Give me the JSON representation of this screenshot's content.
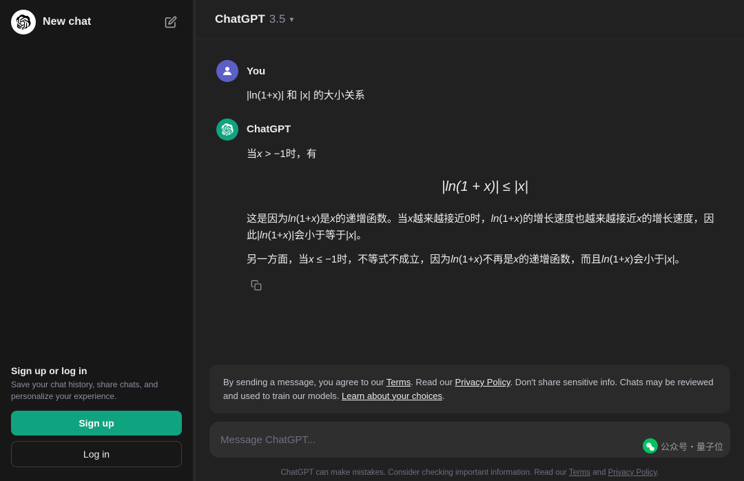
{
  "sidebar": {
    "brand": {
      "title": "New chat"
    },
    "new_chat_label": "New chat"
  },
  "header": {
    "model_name": "ChatGPT",
    "model_version": "3.5",
    "chevron": "▾"
  },
  "messages": [
    {
      "role": "user",
      "author": "You",
      "content": "|ln(1+x)| 和 |x| 的大小关系"
    },
    {
      "role": "assistant",
      "author": "ChatGPT",
      "intro": "当x > −1时，有",
      "math_block": "|ln(1 + x)| ≤ |x|",
      "para1": "这是因为ln(1+x)是x的递增函数。当x越来越接近0时，ln(1+x)的增长速度也越来越接近x的增长速度，因此|ln(1+x)|会小于等于|x|。",
      "para2": "另一方面，当x ≤ −1时，不等式不成立，因为ln(1+x)不再是x的递增函数，而且ln(1+x)会小于|x|。"
    }
  ],
  "disclaimer": {
    "text1": "By sending a message, you agree to our ",
    "terms_label": "Terms",
    "text2": ". Read our ",
    "privacy_label": "Privacy Policy",
    "text3": ". Don't share sensitive info. Chats may be reviewed and used to train our models. ",
    "learn_label": "Learn about your choices",
    "text4": "."
  },
  "input": {
    "placeholder": "Message ChatGPT..."
  },
  "watermark": {
    "icon": "●",
    "text": "公众号・量子位"
  },
  "footer": {
    "text1": "ChatGPT can make mistakes. Consider checking important information. Read our ",
    "terms_label": "Terms",
    "text2": " and ",
    "privacy_label": "Privacy Policy",
    "text3": "."
  },
  "auth": {
    "signup_title": "Sign up or log in",
    "signup_desc": "Save your chat history, share chats, and personalize your experience.",
    "signup_btn": "Sign up",
    "login_btn": "Log in"
  }
}
